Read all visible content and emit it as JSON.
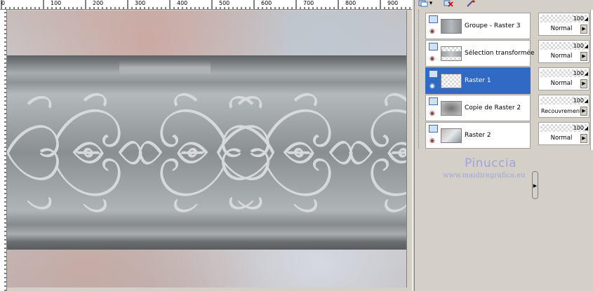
{
  "ruler": {
    "labels": [
      "0",
      "100",
      "200",
      "300",
      "400",
      "500",
      "600",
      "700",
      "800",
      "900"
    ]
  },
  "layers": [
    {
      "name": "Groupe - Raster 3",
      "selected": false
    },
    {
      "name": "Sélection transformée",
      "selected": false
    },
    {
      "name": "Raster 1",
      "selected": true
    },
    {
      "name": "Copie de Raster 2",
      "selected": false
    },
    {
      "name": "Raster 2",
      "selected": false
    }
  ],
  "properties": [
    {
      "opacity": "100",
      "blend": "Normal"
    },
    {
      "opacity": "100",
      "blend": "Normal"
    },
    {
      "opacity": "100",
      "blend": "Normal"
    },
    {
      "opacity": "100",
      "blend": "Recouvrement"
    },
    {
      "opacity": "100",
      "blend": "Normal"
    }
  ],
  "watermark": {
    "title": "Pinuccia",
    "url": "www.maidiregrafica.eu"
  },
  "colors": {
    "selection": "#316ac5",
    "panel": "#d4d0c8",
    "watermark": "#9fa5d6"
  },
  "icons": [
    "layers-palette-icon",
    "delete-layer-icon",
    "edit-icon",
    "eye-icon",
    "expander-arrow-icon"
  ]
}
